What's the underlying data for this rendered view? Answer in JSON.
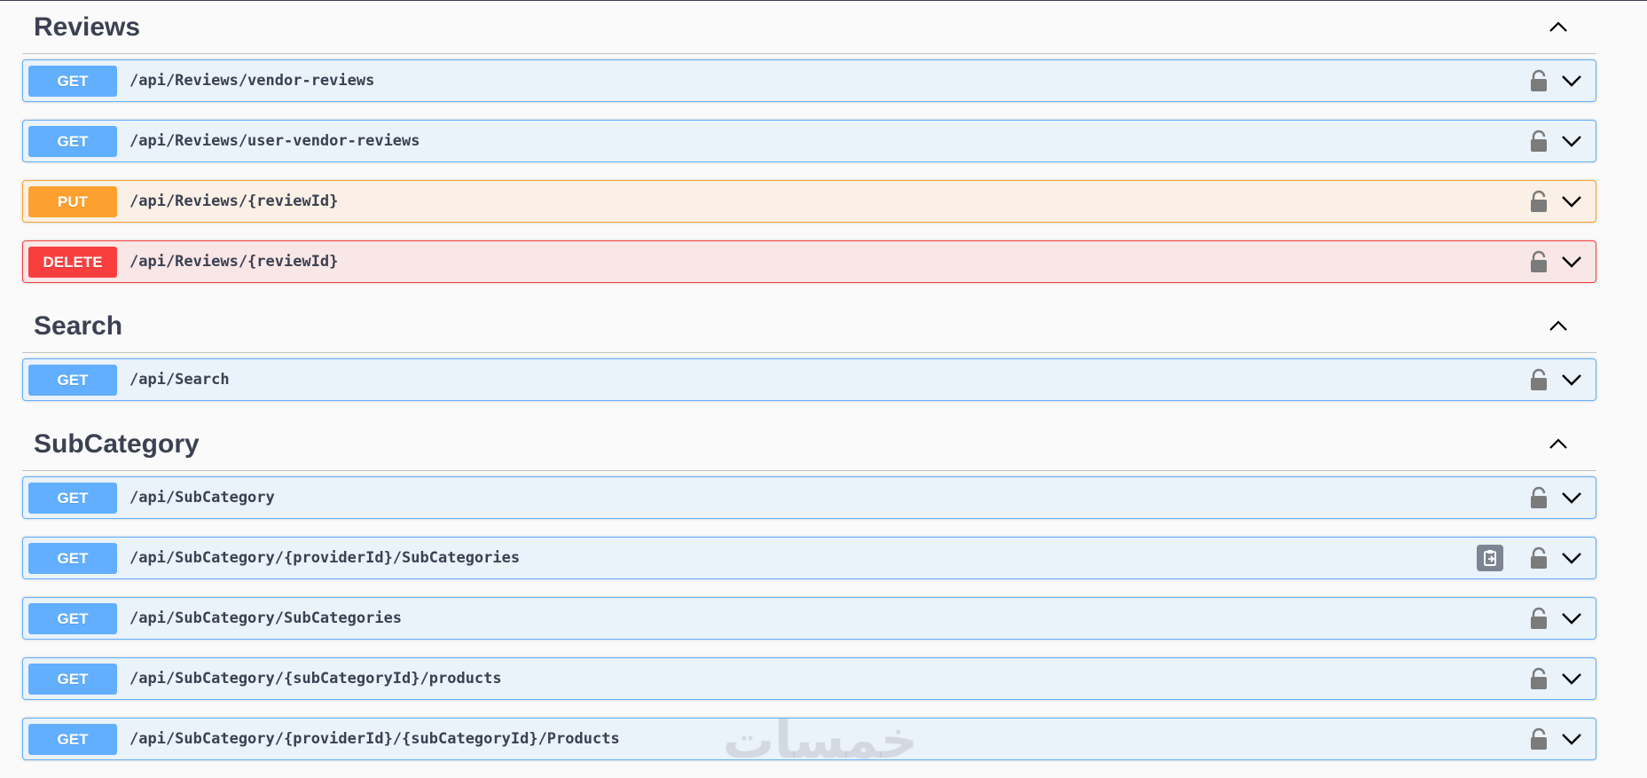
{
  "sections": [
    {
      "title": "Reviews",
      "operations": [
        {
          "method": "GET",
          "path": "/api/Reviews/vendor-reviews"
        },
        {
          "method": "GET",
          "path": "/api/Reviews/user-vendor-reviews"
        },
        {
          "method": "PUT",
          "path": "/api/Reviews/{reviewId}"
        },
        {
          "method": "DELETE",
          "path": "/api/Reviews/{reviewId}"
        }
      ]
    },
    {
      "title": "Search",
      "operations": [
        {
          "method": "GET",
          "path": "/api/Search"
        }
      ]
    },
    {
      "title": "SubCategory",
      "operations": [
        {
          "method": "GET",
          "path": "/api/SubCategory"
        },
        {
          "method": "GET",
          "path": "/api/SubCategory/{providerId}/SubCategories",
          "copy_icon": "copy-to-clipboard-icon"
        },
        {
          "method": "GET",
          "path": "/api/SubCategory/SubCategories"
        },
        {
          "method": "GET",
          "path": "/api/SubCategory/{subCategoryId}/products"
        },
        {
          "method": "GET",
          "path": "/api/SubCategory/{providerId}/{subCategoryId}/Products"
        }
      ]
    }
  ],
  "icons": {
    "collapse": "chevron-up-icon",
    "expand": "chevron-down-icon",
    "lock": "lock-icon"
  },
  "colors": {
    "get": "#61affe",
    "put": "#fca130",
    "delete": "#f93e3e"
  },
  "watermark": "خمسات"
}
